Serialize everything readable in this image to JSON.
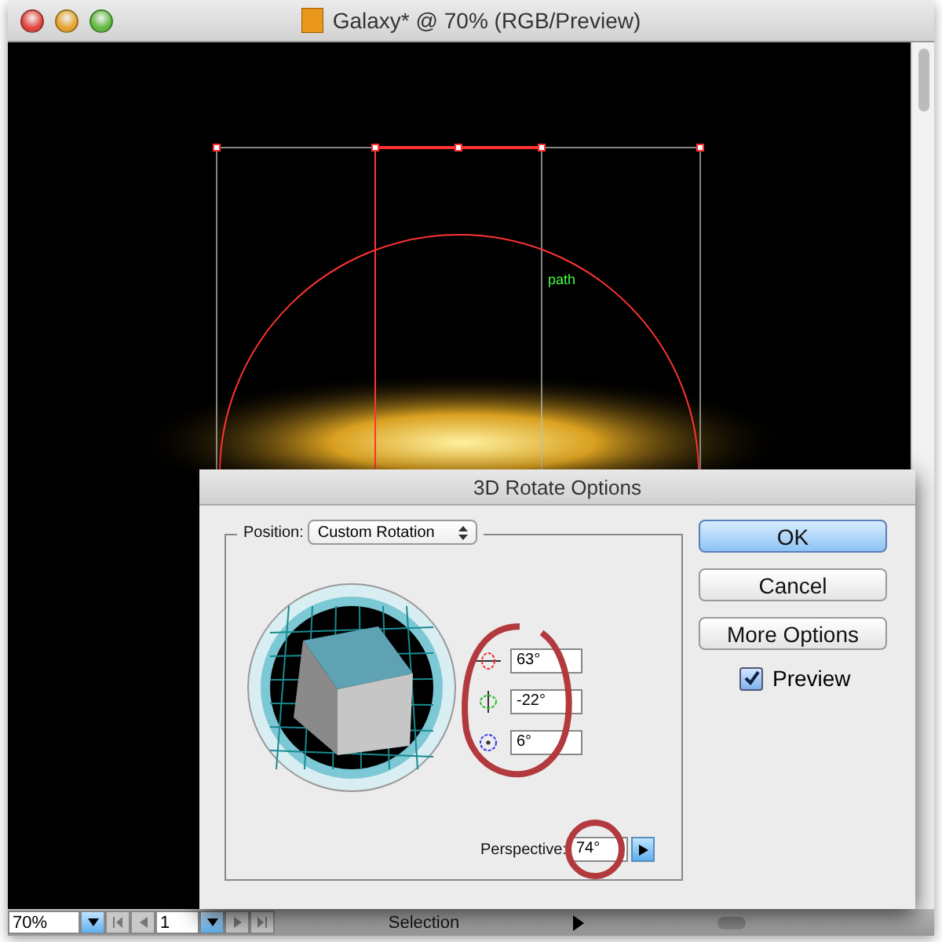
{
  "window": {
    "title": "Galaxy* @ 70% (RGB/Preview)"
  },
  "canvas": {
    "path_label": "path"
  },
  "dialog": {
    "title": "3D Rotate Options",
    "position_label": "Position:",
    "position_value": "Custom Rotation",
    "rotations": [
      {
        "kind": "x",
        "value": "63°"
      },
      {
        "kind": "y",
        "value": "-22°"
      },
      {
        "kind": "z",
        "value": "6°"
      }
    ],
    "perspective": {
      "label": "Perspective:",
      "value": "74°"
    },
    "buttons": [
      {
        "label": "OK",
        "default": true
      },
      {
        "label": "Cancel",
        "default": false
      },
      {
        "label": "More Options",
        "default": false
      }
    ],
    "preview": {
      "label": "Preview",
      "checked": true
    }
  },
  "status_bar": {
    "zoom": "70%",
    "page": "1",
    "tool": "Selection"
  }
}
